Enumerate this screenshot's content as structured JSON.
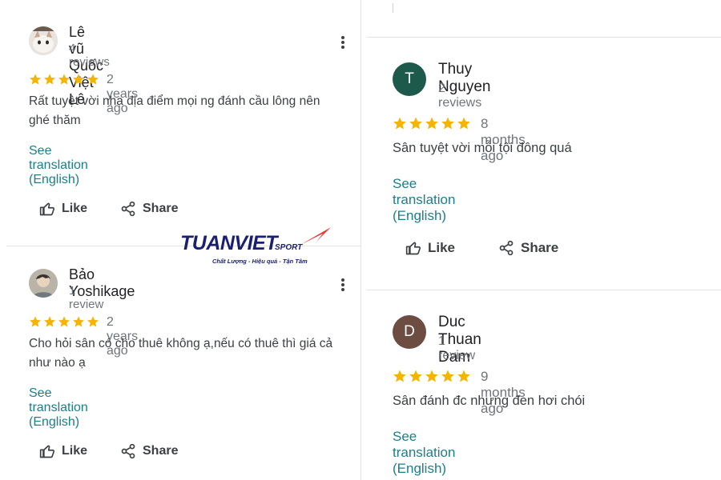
{
  "reviews_left": [
    {
      "author": "Lê vũ Quốc Việt Lê",
      "count": "4 reviews",
      "rating": 5,
      "time": "2 years ago",
      "text": "Rất tuyệt vời nha địa điểm mọi ng đánh cầu lông nên ghé thăm",
      "translation": "See translation (English)",
      "like": "Like",
      "share": "Share"
    },
    {
      "author": "Bảo Yoshikage",
      "count": "1 review",
      "rating": 5,
      "time": "2 years ago",
      "text": "Cho hỏi sân có cho thuê không ạ,nếu có thuê thì giá cả như nào ạ",
      "translation": "See translation (English)",
      "like": "Like",
      "share": "Share"
    }
  ],
  "reviews_right": [
    {
      "author": "Thuy Nguyen",
      "initial": "T",
      "avatar_color": "#1e5a4c",
      "count": "2 reviews",
      "rating": 5,
      "time": "8 months ago",
      "text": "Sân tuyệt vời mỗi tội đông quá",
      "translation": "See translation (English)",
      "like": "Like",
      "share": "Share"
    },
    {
      "author": "Duc Thuan Dam",
      "initial": "D",
      "avatar_color": "#6d4c41",
      "count": "1 review",
      "rating": 5,
      "time": "9 months ago",
      "text": "Sân đánh đc nhưng đen hơi chói",
      "translation": "See translation (English)"
    }
  ],
  "watermark": {
    "brand": "TUANVIET",
    "sub": "SPORT",
    "tagline": "Chất Lượng - Hiệu quả - Tận Tâm"
  },
  "colors": {
    "star": "#f4b400",
    "link": "#1a7f8a"
  }
}
